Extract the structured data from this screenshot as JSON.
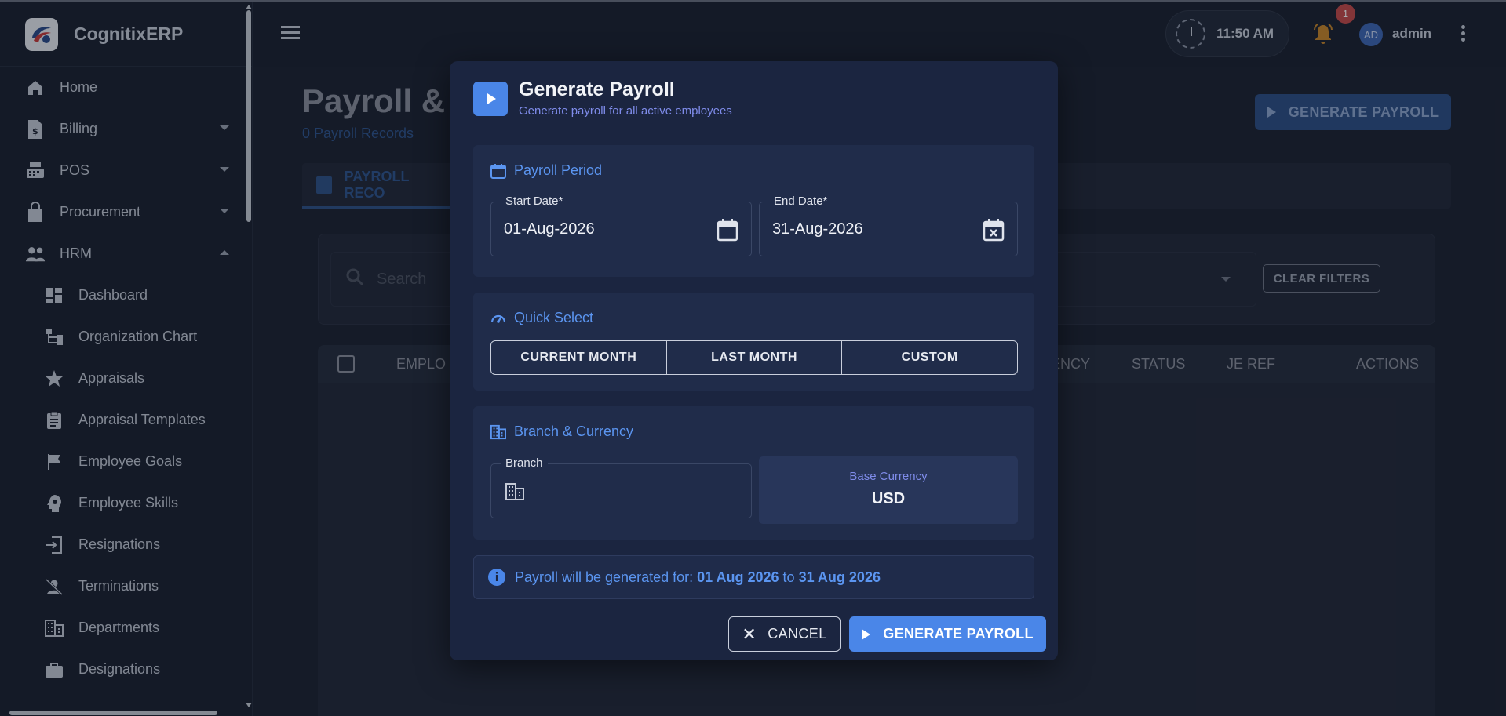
{
  "app": {
    "name": "CognitixERP"
  },
  "sidebar": {
    "items": [
      {
        "label": "Home",
        "icon": "home-icon"
      },
      {
        "label": "Billing",
        "icon": "billing-icon",
        "expandable": true
      },
      {
        "label": "POS",
        "icon": "pos-icon",
        "expandable": true
      },
      {
        "label": "Procurement",
        "icon": "shopping-bag-icon",
        "expandable": true
      },
      {
        "label": "HRM",
        "icon": "people-icon",
        "expanded": true
      }
    ],
    "hrm_items": [
      {
        "label": "Dashboard",
        "icon": "dashboard-icon"
      },
      {
        "label": "Organization Chart",
        "icon": "org-chart-icon"
      },
      {
        "label": "Appraisals",
        "icon": "star-icon"
      },
      {
        "label": "Appraisal Templates",
        "icon": "clipboard-icon"
      },
      {
        "label": "Employee Goals",
        "icon": "flag-icon"
      },
      {
        "label": "Employee Skills",
        "icon": "skills-icon"
      },
      {
        "label": "Resignations",
        "icon": "exit-icon"
      },
      {
        "label": "Terminations",
        "icon": "person-off-icon"
      },
      {
        "label": "Departments",
        "icon": "building-icon"
      },
      {
        "label": "Designations",
        "icon": "briefcase-icon"
      }
    ]
  },
  "topbar": {
    "time": "11:50 AM",
    "notification_count": "1",
    "avatar_initials": "AD",
    "username": "admin"
  },
  "page": {
    "title": "Payroll &",
    "subtitle": "0 Payroll Records",
    "generate_label": "GENERATE PAYROLL",
    "tab_label": "PAYROLL RECO",
    "search_placeholder": "Search",
    "clear_filters": "CLEAR FILTERS",
    "columns": [
      "EMPLO",
      "ENCY",
      "STATUS",
      "JE REF",
      "ACTIONS"
    ]
  },
  "dialog": {
    "title": "Generate Payroll",
    "subtitle": "Generate payroll for all active employees",
    "period": {
      "heading": "Payroll Period",
      "start_label": "Start Date*",
      "start_value": "01-Aug-2026",
      "end_label": "End Date*",
      "end_value": "31-Aug-2026"
    },
    "quick_select": {
      "heading": "Quick Select",
      "options": [
        "CURRENT MONTH",
        "LAST MONTH",
        "CUSTOM"
      ]
    },
    "branch": {
      "heading": "Branch & Currency",
      "branch_label": "Branch",
      "currency_label": "Base Currency",
      "currency_value": "USD"
    },
    "info": {
      "prefix": "Payroll will be generated for:",
      "from": "01 Aug 2026",
      "to_word": "to",
      "to": "31 Aug 2026"
    },
    "cancel_label": "CANCEL",
    "generate_label": "GENERATE PAYROLL"
  },
  "colors": {
    "accent": "#4a86e8",
    "dialog_bg": "#1b2540",
    "section_bg": "#202c4a"
  }
}
